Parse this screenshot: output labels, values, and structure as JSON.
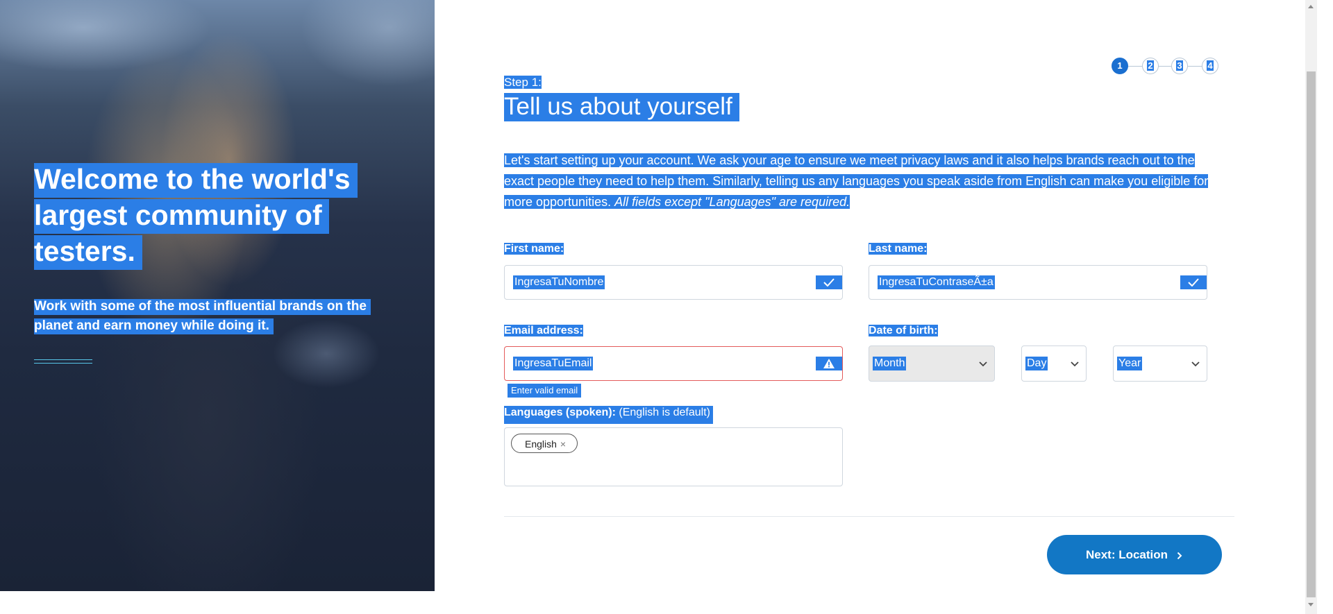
{
  "hero": {
    "title": "Welcome to the world's largest community of testers.",
    "subtitle": "Work with some of the most influential brands on the planet and earn money while doing it."
  },
  "stepper": {
    "steps": [
      "1",
      "2",
      "3",
      "4"
    ],
    "current": 1
  },
  "header": {
    "step_label": "Step 1:",
    "title": "Tell us about yourself",
    "intro": "Let's start setting up your account. We ask your age to ensure we meet privacy laws and it also helps brands reach out to the exact people they need to help them. Similarly, telling us any languages you speak aside from English can make you eligible for more opportunities.",
    "intro_note": "All fields except \"Languages\" are required."
  },
  "form": {
    "first_name": {
      "label": "First name:",
      "value": "IngresaTuNombre",
      "icon": "check-icon"
    },
    "last_name": {
      "label": "Last name:",
      "value": "IngresaTuContraseÃ±a",
      "icon": "check-icon"
    },
    "email": {
      "label": "Email address:",
      "value": "IngresaTuEmail",
      "icon": "warning-icon",
      "error": "Enter valid email"
    },
    "dob": {
      "label": "Date of birth:",
      "month": "Month",
      "day": "Day",
      "year": "Year"
    },
    "languages": {
      "label": "Languages (spoken):",
      "label_note": "(English is default)",
      "chips": [
        "English"
      ]
    }
  },
  "actions": {
    "next_label": "Next: Location"
  },
  "colors": {
    "selection": "#2b7ee6",
    "primary": "#1277c5",
    "error": "#e45a5a",
    "accent_rule": "#58c7ea"
  }
}
